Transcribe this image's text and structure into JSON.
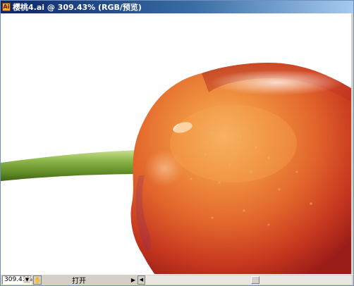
{
  "window": {
    "title": "樱桃4.ai @ 309.43% (RGB/预览)"
  },
  "statusbar": {
    "zoom": "309.43%",
    "status_text": "打开"
  },
  "icons": {
    "app": "illustrator-document-icon",
    "zoom_dropdown": "chevron-down-icon",
    "nav": "hand-icon",
    "play": "play-icon",
    "scroll_left": "arrow-left-icon"
  },
  "colors": {
    "titlebar_start": "#0a246a",
    "titlebar_end": "#a6caf0",
    "cherry_main": "#e8743a",
    "cherry_dark": "#b5261a",
    "stem": "#6d9a2f"
  }
}
